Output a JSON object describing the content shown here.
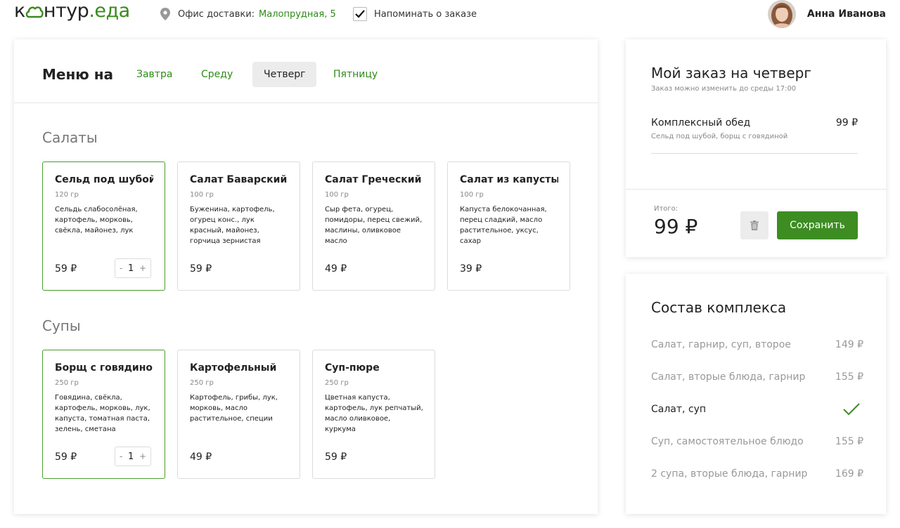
{
  "header": {
    "logo_text": "к",
    "logo_mid": "нтур",
    "logo_suffix": ".еда",
    "office_label": "Офис доставки:",
    "office_address": "Малопрудная, 5",
    "remind_label": "Напоминать о заказе",
    "remind_checked": true,
    "user_name": "Анна Иванова"
  },
  "menu": {
    "title": "Меню на",
    "days": [
      {
        "label": "Завтра",
        "active": false
      },
      {
        "label": "Среду",
        "active": false
      },
      {
        "label": "Четверг",
        "active": true
      },
      {
        "label": "Пятницу",
        "active": false
      }
    ]
  },
  "sections": [
    {
      "title": "Салаты",
      "items": [
        {
          "name": "Сельд под шубой",
          "weight": "120 гр",
          "desc": "Сельдь слабосолёная, картофель, морковь, свёкла, майонез, лук",
          "price": "59 ₽",
          "selected": true,
          "qty": "1"
        },
        {
          "name": "Салат Баварский",
          "weight": "100 гр",
          "desc": "Буженина, картофель, огурец конс., лук красный, майонез, горчица зернистая",
          "price": "59 ₽",
          "selected": false
        },
        {
          "name": "Салат Греческий",
          "weight": "100 гр",
          "desc": "Сыр фета, огурец, помидоры, перец свежий, маслины, оливковое масло",
          "price": "49 ₽",
          "selected": false
        },
        {
          "name": "Салат из капусты",
          "weight": "100 гр",
          "desc": "Капуста белокочанная, перец сладкий, масло растительное, уксус, сахар",
          "price": "39 ₽",
          "selected": false
        }
      ]
    },
    {
      "title": "Супы",
      "items": [
        {
          "name": "Борщ с говядиной",
          "weight": "250 гр",
          "desc": "Говядина, свёкла, картофель, морковь, лук, капуста, томатная паста, зелень, сметана",
          "price": "59 ₽",
          "selected": true,
          "qty": "1"
        },
        {
          "name": "Картофельный",
          "weight": "250 гр",
          "desc": "Картофель, грибы, лук, морковь, масло растительное, специи",
          "price": "49 ₽",
          "selected": false
        },
        {
          "name": "Суп-пюре",
          "weight": "250 гр",
          "desc": "Цветная капуста, картофель, лук репчатый, масло оливковое, куркума",
          "price": "59 ₽",
          "selected": false
        }
      ]
    }
  ],
  "stepper": {
    "minus": "-",
    "plus": "+"
  },
  "order": {
    "title": "Мой заказ на четверг",
    "subtitle": "Заказ можно изменить до среды 17:00",
    "item": {
      "name": "Комплексный обед",
      "desc": "Сельд под шубой, борщ с говядиной",
      "price": "99 ₽"
    },
    "total_label": "Итого:",
    "total_value": "99 ₽",
    "save_label": "Сохранить"
  },
  "complex": {
    "title": "Состав комплекса",
    "options": [
      {
        "label": "Салат, гарнир, суп, второе",
        "price": "149 ₽",
        "active": false
      },
      {
        "label": "Салат, вторые блюда, гарнир",
        "price": "155 ₽",
        "active": false
      },
      {
        "label": "Салат, суп",
        "price": "",
        "active": true
      },
      {
        "label": "Суп, самостоятельное блюдо",
        "price": "155 ₽",
        "active": false
      },
      {
        "label": "2 супа, вторые блюда, гарнир",
        "price": "169 ₽",
        "active": false
      }
    ]
  },
  "colors": {
    "accent_green": "#3d8d22",
    "link_green": "#2e8a18",
    "selected_border": "#4a9e2a"
  },
  "icons": [
    "location-pin-icon",
    "checkbox-check-icon",
    "trash-icon",
    "checkmark-icon",
    "logo-cloud-icon"
  ]
}
